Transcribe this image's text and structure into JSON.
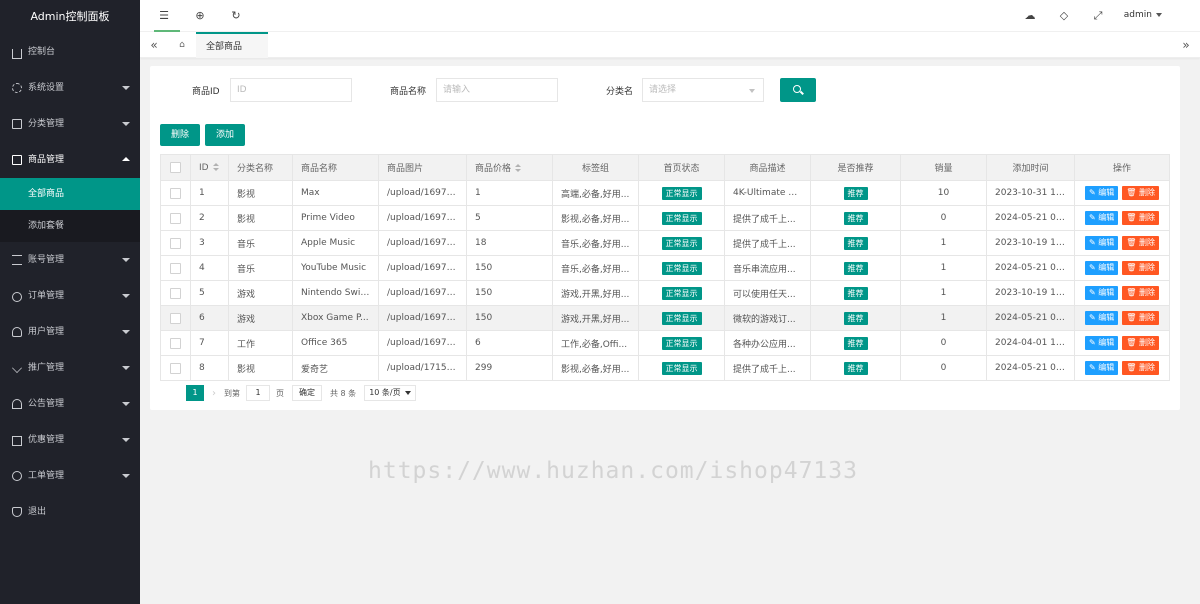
{
  "sidebar": {
    "brand": "Admin控制面板",
    "items": [
      {
        "label": "控制台",
        "icon": "home-icon",
        "has_arrow": false
      },
      {
        "label": "系统设置",
        "icon": "gear-icon",
        "has_arrow": true
      },
      {
        "label": "分类管理",
        "icon": "grid-icon",
        "has_arrow": true
      },
      {
        "label": "商品管理",
        "icon": "box-icon",
        "has_arrow": true,
        "open": true
      },
      {
        "label": "账号管理",
        "icon": "account-icon",
        "has_arrow": true
      },
      {
        "label": "订单管理",
        "icon": "link-icon",
        "has_arrow": true
      },
      {
        "label": "用户管理",
        "icon": "user-icon",
        "has_arrow": true
      },
      {
        "label": "推广管理",
        "icon": "share-icon",
        "has_arrow": true
      },
      {
        "label": "公告管理",
        "icon": "bell-icon",
        "has_arrow": true
      },
      {
        "label": "优惠管理",
        "icon": "card-icon",
        "has_arrow": true
      },
      {
        "label": "工单管理",
        "icon": "clock-icon",
        "has_arrow": true
      },
      {
        "label": "退出",
        "icon": "shield-icon",
        "has_arrow": false
      }
    ],
    "sub_items": [
      {
        "label": "全部商品",
        "active": true
      },
      {
        "label": "添加套餐",
        "active": false
      }
    ]
  },
  "topbar": {
    "admin_label": "admin"
  },
  "tabs": {
    "active_tab": "全部商品",
    "close_glyph": "×"
  },
  "search": {
    "id_label": "商品ID",
    "id_placeholder": "ID",
    "name_label": "商品名称",
    "name_placeholder": "请输入",
    "category_label": "分类名",
    "category_placeholder": "请选择"
  },
  "toolbar": {
    "delete_label": "删除",
    "add_label": "添加"
  },
  "table": {
    "headers": [
      "",
      "ID",
      "分类名称",
      "商品名称",
      "商品图片",
      "商品价格",
      "标签组",
      "首页状态",
      "商品描述",
      "是否推荐",
      "销量",
      "添加时间",
      "操作"
    ],
    "edit_label": "编辑",
    "delete_label": "删除",
    "rows": [
      {
        "id": "1",
        "category": "影视",
        "name": "Max",
        "image": "/upload/16976...",
        "price": "1",
        "tags": "高端,必备,好用...",
        "home_status": "正常显示",
        "desc": "4K-Ultimate A...",
        "recommend": "推荐",
        "sales": "10",
        "added": "2023-10-31 14..."
      },
      {
        "id": "2",
        "category": "影视",
        "name": "Prime Video",
        "image": "/upload/16976...",
        "price": "5",
        "tags": "影视,必备,好用...",
        "home_status": "正常显示",
        "desc": "提供了成千上...",
        "recommend": "推荐",
        "sales": "0",
        "added": "2024-05-21 01..."
      },
      {
        "id": "3",
        "category": "音乐",
        "name": "Apple Music",
        "image": "/upload/16976...",
        "price": "18",
        "tags": "音乐,必备,好用...",
        "home_status": "正常显示",
        "desc": "提供了成千上...",
        "recommend": "推荐",
        "sales": "1",
        "added": "2023-10-19 12..."
      },
      {
        "id": "4",
        "category": "音乐",
        "name": "YouTube Music",
        "image": "/upload/16976...",
        "price": "150",
        "tags": "音乐,必备,好用...",
        "home_status": "正常显示",
        "desc": "音乐串流应用...",
        "recommend": "推荐",
        "sales": "1",
        "added": "2024-05-21 01..."
      },
      {
        "id": "5",
        "category": "游戏",
        "name": "Nintendo Swit...",
        "image": "/upload/16976...",
        "price": "150",
        "tags": "游戏,开黑,好用...",
        "home_status": "正常显示",
        "desc": "可以使用任天...",
        "recommend": "推荐",
        "sales": "1",
        "added": "2023-10-19 11..."
      },
      {
        "id": "6",
        "category": "游戏",
        "name": "Xbox Game P...",
        "image": "/upload/16976...",
        "price": "150",
        "tags": "游戏,开黑,好用...",
        "home_status": "正常显示",
        "desc": "微软的游戏订...",
        "recommend": "推荐",
        "sales": "1",
        "added": "2024-05-21 01..."
      },
      {
        "id": "7",
        "category": "工作",
        "name": "Office 365",
        "image": "/upload/16976...",
        "price": "6",
        "tags": "工作,必备,Offi...",
        "home_status": "正常显示",
        "desc": "各种办公应用...",
        "recommend": "推荐",
        "sales": "0",
        "added": "2024-04-01 11..."
      },
      {
        "id": "8",
        "category": "影视",
        "name": "爱奇艺",
        "image": "/upload/17152...",
        "price": "299",
        "tags": "影视,必备,好用...",
        "home_status": "正常显示",
        "desc": "提供了成千上...",
        "recommend": "推荐",
        "sales": "0",
        "added": "2024-05-21 01..."
      }
    ]
  },
  "pager": {
    "current": "1",
    "goto_label": "到第",
    "page_value": "1",
    "page_suffix": "页",
    "confirm_label": "确定",
    "total_label": "共 8 条",
    "size_label": "10 条/页"
  },
  "watermark": {
    "url_text": "https://www.huzhan.com/ishop47133"
  }
}
